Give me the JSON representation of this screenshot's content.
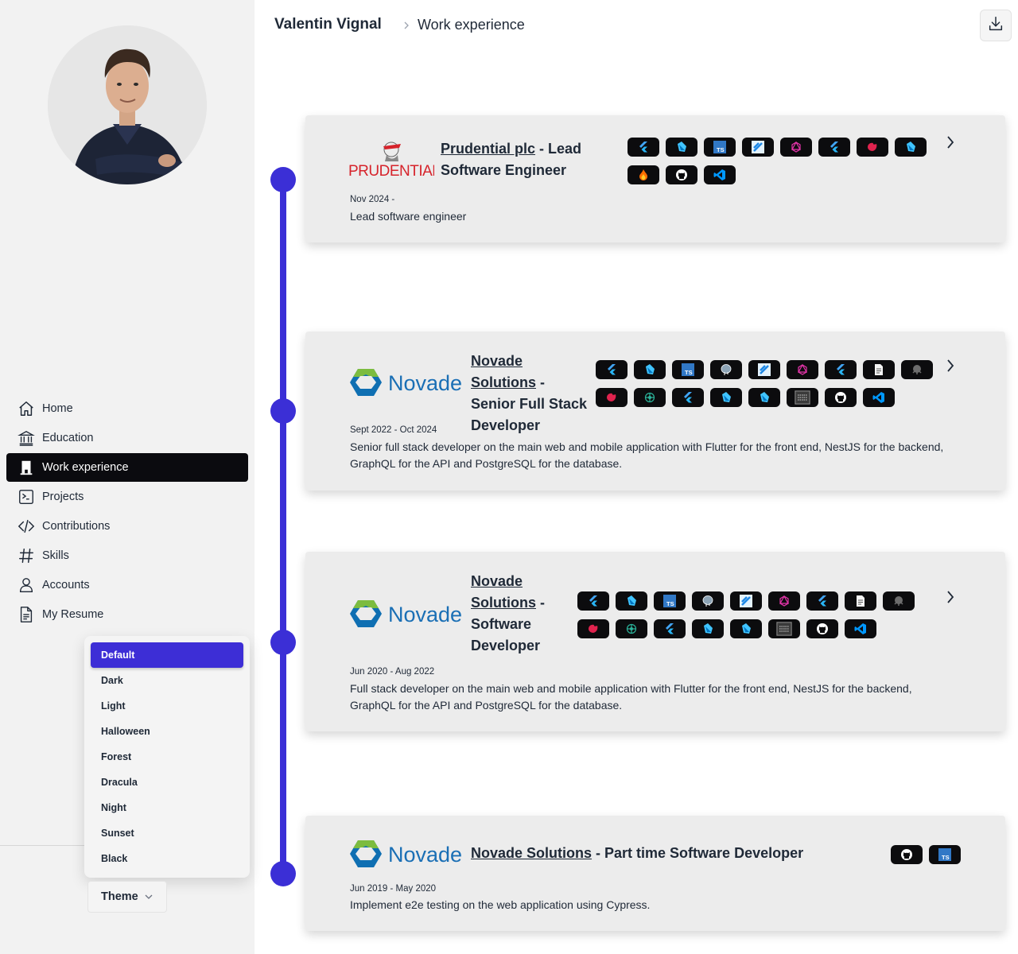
{
  "header": {
    "name": "Valentin Vignal",
    "current_page": "Work experience"
  },
  "sidebar": {
    "items": [
      {
        "label": "Home",
        "icon": "home-icon"
      },
      {
        "label": "Education",
        "icon": "school-icon"
      },
      {
        "label": "Work experience",
        "icon": "building-icon",
        "active": true
      },
      {
        "label": "Projects",
        "icon": "terminal-icon"
      },
      {
        "label": "Contributions",
        "icon": "code-icon"
      },
      {
        "label": "Skills",
        "icon": "hashtag-icon"
      },
      {
        "label": "Accounts",
        "icon": "user-icon"
      },
      {
        "label": "My Resume",
        "icon": "document-icon"
      }
    ],
    "theme_menu": {
      "options": [
        "Default",
        "Dark",
        "Light",
        "Halloween",
        "Forest",
        "Dracula",
        "Night",
        "Sunset",
        "Black"
      ],
      "selected": "Default"
    },
    "theme_button_label": "Theme"
  },
  "colors": {
    "accent": "#3b2fd6",
    "active_nav": "#0b0b0f",
    "card_bg": "#ececec"
  },
  "experiences": [
    {
      "company": "Prudential plc",
      "role": "- Lead Software Engineer",
      "logo": "Prudential",
      "date": "Nov 2024 -",
      "description": "Lead software engineer",
      "skills": [
        "flutter",
        "dart",
        "typescript",
        "flutter-flow",
        "graphql",
        "flutter",
        "nestjs",
        "dart",
        "firebase",
        "github",
        "vscode"
      ]
    },
    {
      "company": "Novade Solutions",
      "role": "- Senior Full Stack Developer",
      "logo": "Novade",
      "date": "Sept 2022 - Oct 2024",
      "description": "Senior full stack developer on the main web and mobile application with Flutter for the front end, NestJS for the backend, GraphQL for the API and PostgreSQL for the database.",
      "skills": [
        "flutter",
        "dart",
        "typescript",
        "postgresql",
        "flutter-flow",
        "graphql",
        "flutter",
        "markdown",
        "gitkraken",
        "nestjs",
        "apollo",
        "flutter",
        "dart",
        "dart",
        "sqlite",
        "github",
        "vscode"
      ]
    },
    {
      "company": "Novade Solutions",
      "role": "- Software Developer",
      "logo": "Novade",
      "date": "Jun 2020 - Aug 2022",
      "description": "Full stack developer on the main web and mobile application with Flutter for the front end, NestJS for the backend, GraphQL for the API and PostgreSQL for the database.",
      "skills": [
        "flutter",
        "dart",
        "typescript",
        "postgresql",
        "flutter-flow",
        "graphql",
        "flutter",
        "markdown",
        "gitkraken",
        "nestjs",
        "apollo",
        "flutter",
        "dart",
        "dart",
        "sqlite",
        "github",
        "vscode"
      ]
    },
    {
      "company": "Novade Solutions",
      "role": "- Part time Software Developer",
      "logo": "Novade",
      "date": "Jun 2019 - May 2020",
      "description": "Implement e2e testing on the web application using Cypress.",
      "skills": [
        "github",
        "typescript"
      ]
    }
  ],
  "ui_icons": {
    "expand": "chevron-right-icon",
    "download": "download-icon",
    "breadcrumb_separator": "chevron-right-icon",
    "theme_dropdown": "chevron-down-icon"
  }
}
